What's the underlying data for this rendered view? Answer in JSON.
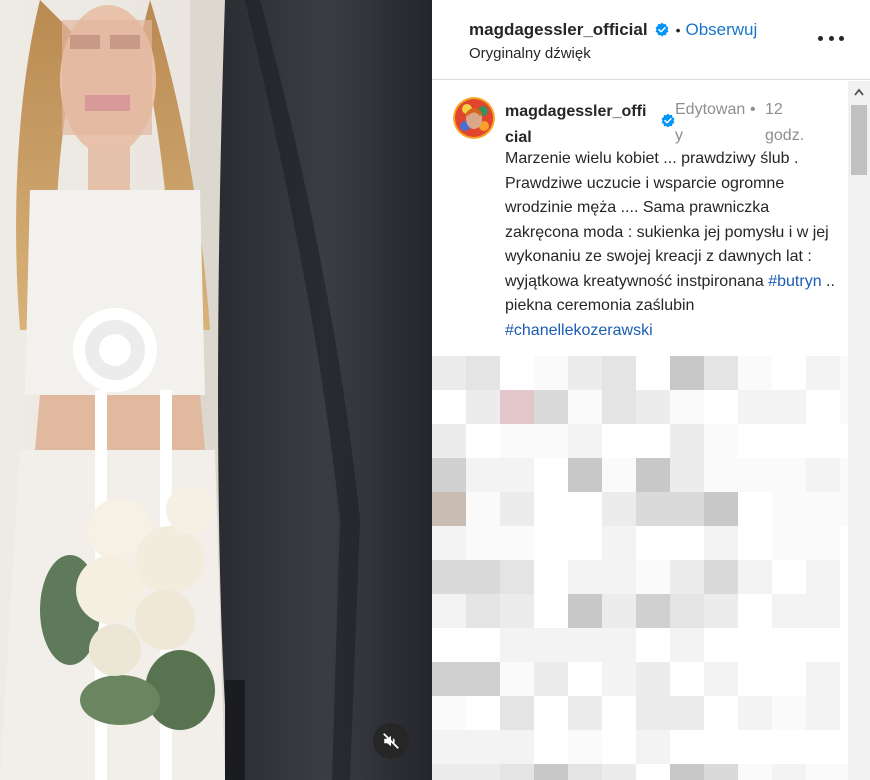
{
  "post_header": {
    "username": "magdagessler_official",
    "dot": "•",
    "follow_label": "Obserwuj",
    "audio_label": "Oryginalny dźwięk",
    "more_icon": "more-horizontal-icon"
  },
  "caption": {
    "username": "magdagessler_official",
    "edited": "Edytowany",
    "dot": "•",
    "time": "12 godz.",
    "text_part1": "Marzenie wielu kobiet ... prawdziwy ślub . Prawdziwe uczucie i wsparcie ogromne wrodzinie męża .... Sama prawniczka zakręcona moda : sukienka jej pomysłu i w jej wykonaniu ze swojej kreacji z dawnych lat : wyjątkowa kreatywność instpironana ",
    "hashtag1": "#butryn",
    "text_part2": " .. piekna ceremonia zaślubin ",
    "hashtag2": "#chanellekozerawski"
  },
  "colors": {
    "link_blue": "#1877cc",
    "verified_blue": "#0095f6",
    "muted_gray": "#8e8e8e"
  },
  "icons": {
    "mute": "speaker-muted-icon",
    "verified": "verified-badge-icon",
    "scroll_up": "chevron-up-icon"
  }
}
